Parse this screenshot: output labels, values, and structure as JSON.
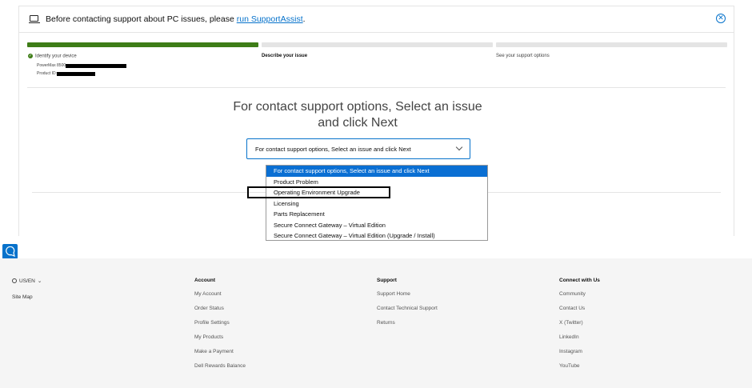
{
  "banner": {
    "text": "Before contacting support about PC issues, please ",
    "link": "run SupportAssist",
    "suffix": "."
  },
  "steps": [
    {
      "label": "Identify your device",
      "status": "complete"
    },
    {
      "label": "Describe your issue",
      "status": "active"
    },
    {
      "label": "See your support options",
      "status": "pending"
    }
  ],
  "device": {
    "model_label": "PowerMax 8500",
    "product_id_label": "Product ID:"
  },
  "heading": "For contact support options, Select an issue and click Next",
  "select": {
    "value": "For contact support options, Select an issue and click Next",
    "options": [
      "For contact support options, Select an issue and click Next",
      "Product Problem",
      "Operating Environment Upgrade",
      "Licensing",
      "Parts Replacement",
      "Secure Connect Gateway – Virtual Edition",
      "Secure Connect Gateway – Virtual Edition (Upgrade / Install)"
    ]
  },
  "footer": {
    "locale": "US/EN",
    "site_map": "Site Map",
    "columns": [
      {
        "title": "Account",
        "links": [
          "My Account",
          "Order Status",
          "Profile Settings",
          "My Products",
          "Make a Payment",
          "Dell Rewards Balance"
        ]
      },
      {
        "title": "Support",
        "links": [
          "Support Home",
          "Contact Technical Support",
          "Returns"
        ]
      },
      {
        "title": "Connect with Us",
        "links": [
          "Community",
          "Contact Us",
          "X (Twitter)",
          "LinkedIn",
          "Instagram",
          "YouTube"
        ]
      }
    ]
  },
  "icons": {
    "banner": "laptop-icon",
    "close": "close-circle-icon",
    "chat": "chat-icon",
    "locale": "globe-icon"
  },
  "colors": {
    "accent": "#0672cb",
    "progress_complete": "#3e7d17",
    "progress_pending": "#e4e4e4",
    "selected_option": "#0a6fd3"
  }
}
